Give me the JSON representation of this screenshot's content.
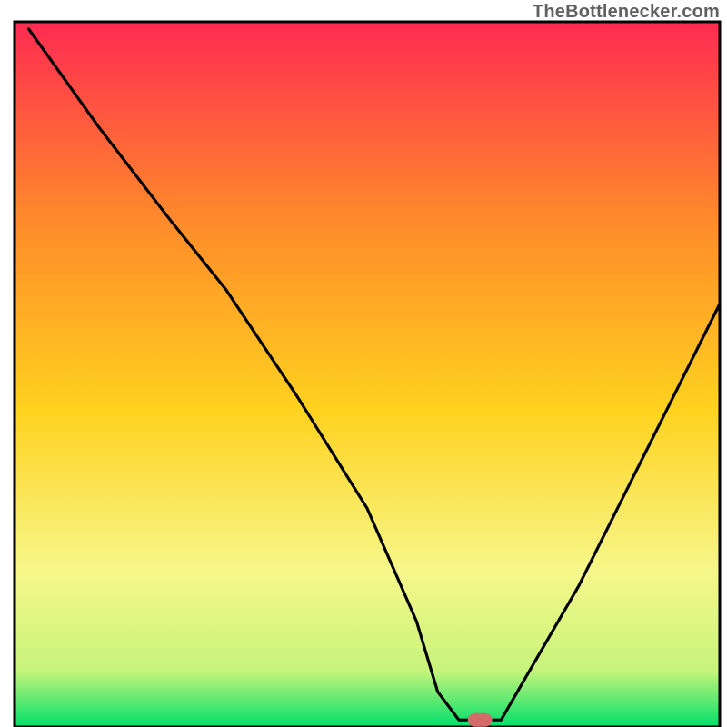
{
  "watermark": "TheBottlenecker.com",
  "chart_data": {
    "type": "line",
    "title": "",
    "xlabel": "",
    "ylabel": "",
    "xlim": [
      0,
      100
    ],
    "ylim": [
      0,
      100
    ],
    "grid": false,
    "legend": false,
    "series": [
      {
        "name": "bottleneck-curve",
        "x": [
          2,
          12,
          22,
          30,
          40,
          50,
          57,
          60,
          63,
          69,
          80,
          90,
          100
        ],
        "values": [
          99,
          85,
          72,
          62,
          47,
          31,
          15,
          5,
          1,
          1,
          20,
          40,
          60
        ]
      }
    ],
    "marker": {
      "name": "optimal-point",
      "x": 66,
      "y": 1
    },
    "axes_box": {
      "x": 2,
      "y": 3,
      "w": 97,
      "h": 97
    }
  },
  "colors": {
    "gradient_top": "#ff2b52",
    "gradient_mid_upper": "#ff8a2a",
    "gradient_mid": "#ffd21f",
    "gradient_lower": "#f6f78a",
    "gradient_bottom": "#00e06a",
    "axis": "#000000",
    "curve": "#000000",
    "marker_fill": "#d46a6a",
    "marker_stroke": "#d46a6a"
  }
}
